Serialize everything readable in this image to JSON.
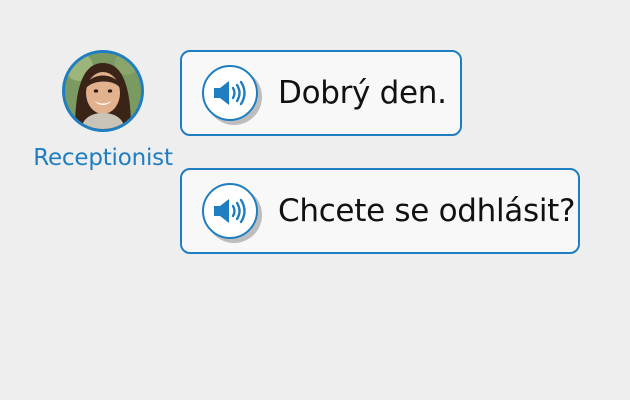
{
  "speaker": {
    "name": "Receptionist",
    "avatar_icon": "woman-portrait"
  },
  "messages": [
    {
      "text": "Dobrý den.",
      "audio_icon": "speaker-volume-icon"
    },
    {
      "text": "Chcete se odhlásit?",
      "audio_icon": "speaker-volume-icon"
    }
  ],
  "colors": {
    "accent": "#1f7ec1",
    "background": "#eeeeee",
    "bubble": "#f8f8f8"
  }
}
